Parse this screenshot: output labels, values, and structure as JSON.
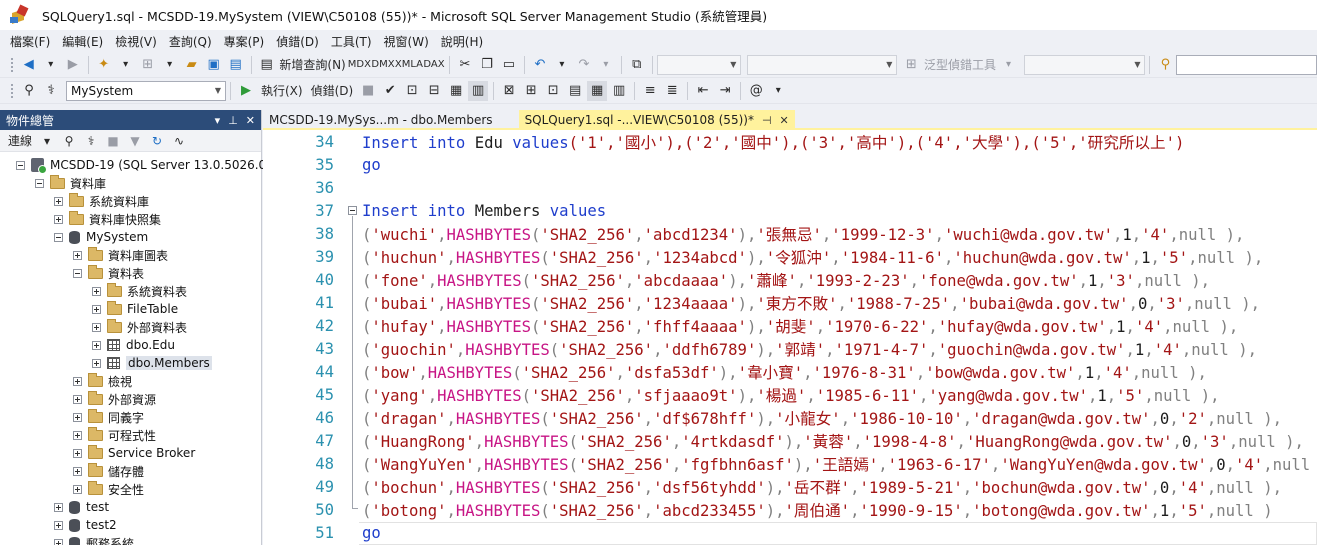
{
  "window": {
    "title": "SQLQuery1.sql - MCSDD-19.MySystem (VIEW\\C50108 (55))* - Microsoft SQL Server Management Studio (系統管理員)"
  },
  "menu": [
    "檔案(F)",
    "編輯(E)",
    "檢視(V)",
    "查詢(Q)",
    "專案(P)",
    "偵錯(D)",
    "工具(T)",
    "視窗(W)",
    "說明(H)"
  ],
  "toolbar1": {
    "new_query_label": "新增查詢(N)",
    "mdx": "MDX",
    "dmx": "DMX",
    "xmla": "XMLA",
    "dax": "DAX",
    "generic_debug_tools": "泛型偵錯工具"
  },
  "toolbar2": {
    "database": "MySystem",
    "execute_label": "執行(X)",
    "debug_label": "偵錯(D)"
  },
  "object_explorer": {
    "title": "物件總管",
    "connect_label": "連線",
    "pin_label": "ᚔ"
  },
  "tree": [
    {
      "label": "MCSDD-19 (SQL Server 13.0.5026.0"
    },
    {
      "label": "資料庫"
    },
    {
      "label": "系統資料庫"
    },
    {
      "label": "資料庫快照集"
    },
    {
      "label": "MySystem"
    },
    {
      "label": "資料庫圖表"
    },
    {
      "label": "資料表"
    },
    {
      "label": "系統資料表"
    },
    {
      "label": "FileTable"
    },
    {
      "label": "外部資料表"
    },
    {
      "label": "dbo.Edu"
    },
    {
      "label": "dbo.Members"
    },
    {
      "label": "檢視"
    },
    {
      "label": "外部資源"
    },
    {
      "label": "同義字"
    },
    {
      "label": "可程式性"
    },
    {
      "label": "Service Broker"
    },
    {
      "label": "儲存體"
    },
    {
      "label": "安全性"
    },
    {
      "label": "test"
    },
    {
      "label": "test2"
    },
    {
      "label": "郵務系統"
    }
  ],
  "tabs": {
    "inactive": "MCSDD-19.MySys...m - dbo.Members",
    "active": "SQLQuery1.sql -...VIEW\\C50108 (55))*"
  },
  "editor": {
    "line_numbers": [
      "34",
      "35",
      "36",
      "37",
      "38",
      "39",
      "40",
      "41",
      "42",
      "43",
      "44",
      "45",
      "46",
      "47",
      "48",
      "49",
      "50",
      "51"
    ],
    "line34": {
      "kw1": "Insert",
      "kw2": "into",
      "obj": "Edu",
      "kw3": "values",
      "rest": "('1','國小'),('2','國中'),('3','高中'),('4','大學'),('5','研究所以上')"
    },
    "go": "go",
    "line37": {
      "kw1": "Insert",
      "kw2": "into",
      "obj": "Members",
      "kw3": "values"
    },
    "rows": [
      {
        "user": "'wuchi'",
        "pw": "'abcd1234'",
        "name": "'張無忌'",
        "date": "'1999-12-3'",
        "email": "'wuchi@wda.gov.tw'",
        "n": "1",
        "edu": "'4'",
        "tail": "),"
      },
      {
        "user": "'huchun'",
        "pw": "'1234abcd'",
        "name": "'令狐沖'",
        "date": "'1984-11-6'",
        "email": "'huchun@wda.gov.tw'",
        "n": "1",
        "edu": "'5'",
        "tail": "),"
      },
      {
        "user": "'fone'",
        "pw": "'abcdaaaa'",
        "name": "'蕭峰'",
        "date": "'1993-2-23'",
        "email": "'fone@wda.gov.tw'",
        "n": "1",
        "edu": "'3'",
        "tail": "),"
      },
      {
        "user": "'bubai'",
        "pw": "'1234aaaa'",
        "name": "'東方不敗'",
        "date": "'1988-7-25'",
        "email": "'bubai@wda.gov.tw'",
        "n": "0",
        "edu": "'3'",
        "tail": "),"
      },
      {
        "user": "'hufay'",
        "pw": "'fhff4aaaa'",
        "name": "'胡斐'",
        "date": "'1970-6-22'",
        "email": "'hufay@wda.gov.tw'",
        "n": "1",
        "edu": "'4'",
        "tail": "),"
      },
      {
        "user": "'guochin'",
        "pw": "'ddfh6789'",
        "name": "'郭靖'",
        "date": "'1971-4-7'",
        "email": "'guochin@wda.gov.tw'",
        "n": "1",
        "edu": "'4'",
        "tail": "),"
      },
      {
        "user": "'bow'",
        "pw": "'dsfa53df'",
        "name": "'韋小寶'",
        "date": "'1976-8-31'",
        "email": "'bow@wda.gov.tw'",
        "n": "1",
        "edu": "'4'",
        "tail": "),"
      },
      {
        "user": "'yang'",
        "pw": "'sfjaaao9t'",
        "name": "'楊過'",
        "date": "'1985-6-11'",
        "email": "'yang@wda.gov.tw'",
        "n": "1",
        "edu": "'5'",
        "tail": "),"
      },
      {
        "user": "'dragan'",
        "pw": "'df$678hff'",
        "name": "'小龍女'",
        "date": "'1986-10-10'",
        "email": "'dragan@wda.gov.tw'",
        "n": "0",
        "edu": "'2'",
        "tail": "),"
      },
      {
        "user": "'HuangRong'",
        "pw": "'4rtkdasdf'",
        "name": "'黃蓉'",
        "date": "'1998-4-8'",
        "email": "'HuangRong@wda.gov.tw'",
        "n": "0",
        "edu": "'3'",
        "tail": "),"
      },
      {
        "user": "'WangYuYen'",
        "pw": "'fgfbhn6asf'",
        "name": "'王語嫣'",
        "date": "'1963-6-17'",
        "email": "'WangYuYen@wda.gov.tw'",
        "n": "0",
        "edu": "'4'",
        "tail": "),"
      },
      {
        "user": "'bochun'",
        "pw": "'dsf56tyhdd'",
        "name": "'岳不群'",
        "date": "'1989-5-21'",
        "email": "'bochun@wda.gov.tw'",
        "n": "0",
        "edu": "'4'",
        "tail": "),"
      },
      {
        "user": "'botong'",
        "pw": "'abcd233455'",
        "name": "'周伯通'",
        "date": "'1990-9-15'",
        "email": "'botong@wda.gov.tw'",
        "n": "1",
        "edu": "'5'",
        "tail": ")"
      }
    ],
    "hash_fn": "HASHBYTES",
    "algo": "'SHA2_256'",
    "null_kw": "null"
  }
}
